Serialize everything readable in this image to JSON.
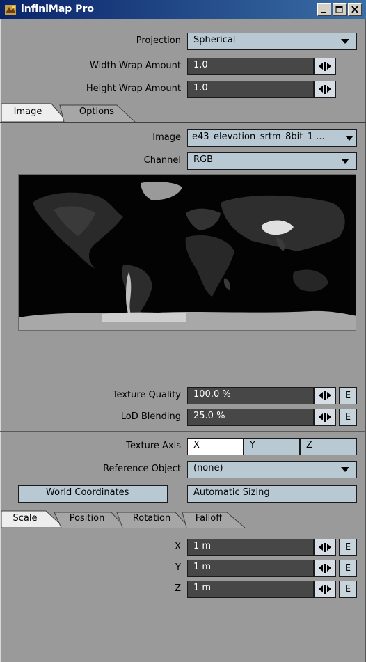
{
  "window": {
    "title": "infiniMap Pro"
  },
  "top": {
    "projection_label": "Projection",
    "projection_value": "Spherical",
    "width_wrap_label": "Width Wrap Amount",
    "width_wrap_value": "1.0",
    "height_wrap_label": "Height Wrap Amount",
    "height_wrap_value": "1.0"
  },
  "tabs_main": [
    "Image",
    "Options"
  ],
  "image_tab": {
    "image_label": "Image",
    "image_value": "e43_elevation_srtm_8bit_1 ...",
    "channel_label": "Channel",
    "channel_value": "RGB",
    "texture_quality_label": "Texture Quality",
    "texture_quality_value": "100.0 %",
    "lod_label": "LoD Blending",
    "lod_value": "25.0 %",
    "env_button": "E"
  },
  "axis": {
    "texture_axis_label": "Texture Axis",
    "axes": [
      "X",
      "Y",
      "Z"
    ],
    "selected": "X",
    "reference_label": "Reference Object",
    "reference_value": "(none)",
    "world_coords_label": "World Coordinates",
    "auto_sizing_label": "Automatic Sizing"
  },
  "tabs_xform": [
    "Scale",
    "Position",
    "Rotation",
    "Falloff"
  ],
  "scale": {
    "x_label": "X",
    "x_value": "1 m",
    "y_label": "Y",
    "y_value": "1 m",
    "z_label": "Z",
    "z_value": "1 m"
  },
  "colors": {
    "titlebar": "#0a246a",
    "panel": "#9a9a9a",
    "field_dark": "#474747",
    "field_light": "#b9c9d4"
  }
}
